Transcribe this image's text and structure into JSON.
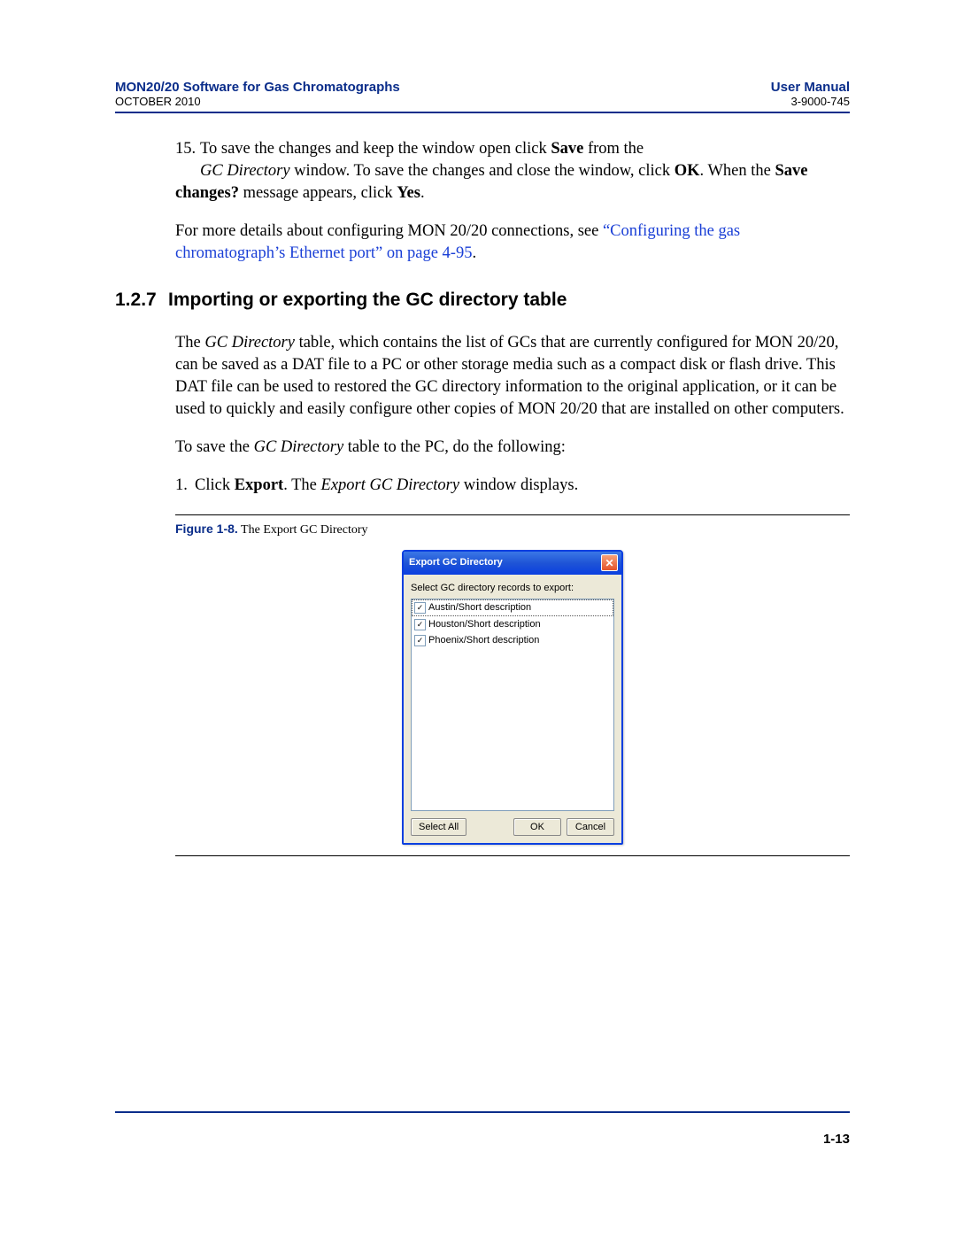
{
  "header": {
    "title_left": "MON20/20 Software for Gas Chromatographs",
    "date_left": "OCTOBER 2010",
    "title_right": "User Manual",
    "code_right": "3-9000-745"
  },
  "step15": {
    "num": "15.",
    "t1": "To save the changes and keep the window open click ",
    "b1": "Save",
    "t2": " from the ",
    "i1": "GC Directory",
    "t3": " window.  To save the changes and close the window, click ",
    "b2": "OK",
    "t4": ".  When the ",
    "b3": "Save changes?",
    "t5": " message appears, click ",
    "b4": "Yes",
    "t6": "."
  },
  "para_more": {
    "t1": "For more details about configuring MON 20/20 connections, see ",
    "link": "“Configuring the gas chromatograph’s Ethernet port” on page 4-95",
    "t2": "."
  },
  "section": {
    "num": "1.2.7",
    "title": "Importing or exporting the GC directory table"
  },
  "para_intro": {
    "t1": "The ",
    "i1": "GC Directory",
    "t2": " table, which contains the list of GCs that are currently configured for MON 20/20, can be saved as a DAT file to a PC or other storage media such as a compact disk or flash drive.  This DAT file can be used to restored the GC directory information to the original application, or it can be used to quickly and easily configure other copies of MON 20/20 that are installed on other computers."
  },
  "para_save": {
    "t1": "To save the ",
    "i1": "GC Directory",
    "t2": " table to the PC, do the following:"
  },
  "list1": {
    "num": "1.",
    "t1": "Click ",
    "b1": "Export",
    "t2": ".  The ",
    "i1": "Export GC Directory",
    "t3": " window displays."
  },
  "figure": {
    "label": "Figure 1-8.",
    "caption": "The Export GC Directory"
  },
  "dialog": {
    "title": "Export GC Directory",
    "close": "✕",
    "prompt": "Select GC directory records to export:",
    "items": [
      "Austin/Short description",
      "Houston/Short description",
      "Phoenix/Short description"
    ],
    "check": "✓",
    "buttons": {
      "select_all": "Select All",
      "ok": "OK",
      "cancel": "Cancel"
    }
  },
  "page_number": "1-13"
}
